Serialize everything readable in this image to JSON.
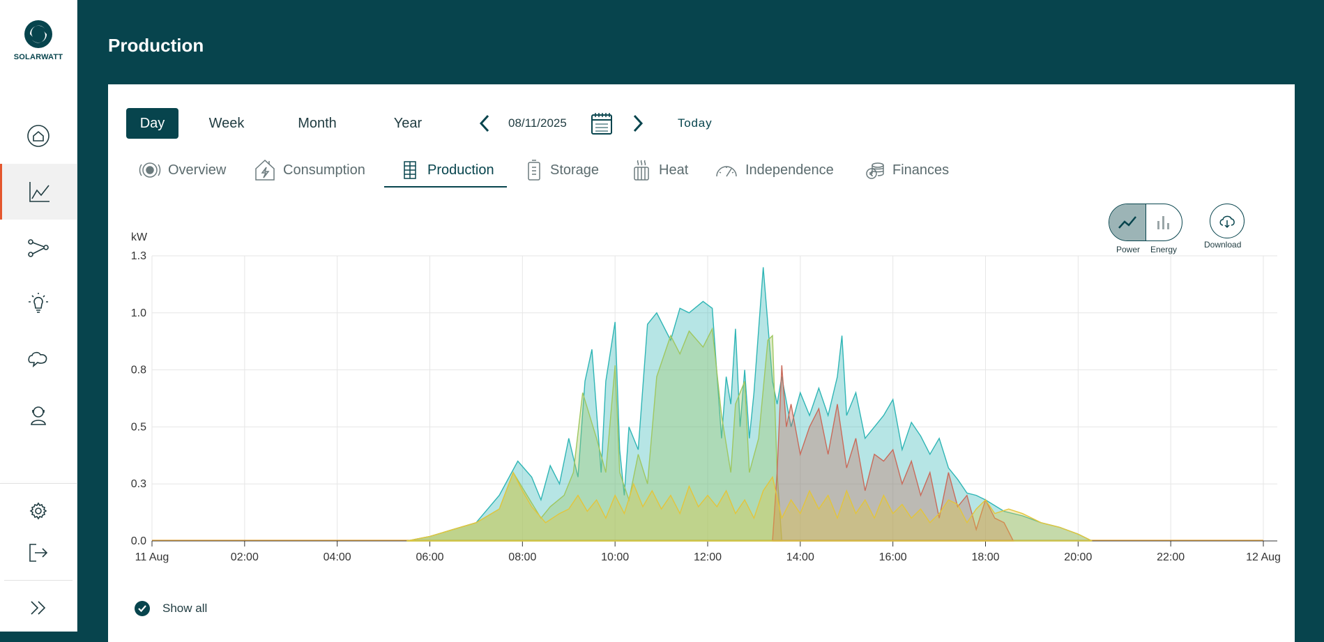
{
  "brand": {
    "name": "SOLARWATT"
  },
  "sidebar": {
    "items": [
      {
        "icon": "home-icon",
        "active": false
      },
      {
        "icon": "chart-icon",
        "active": true
      },
      {
        "icon": "network-icon",
        "active": false
      },
      {
        "icon": "lightbulb-icon",
        "active": false
      },
      {
        "icon": "chat-icon",
        "active": false
      },
      {
        "icon": "support-icon",
        "active": false
      }
    ],
    "bottom": [
      {
        "icon": "gear-icon"
      },
      {
        "icon": "logout-icon"
      },
      {
        "icon": "expand-icon"
      }
    ]
  },
  "header": {
    "title": "Production"
  },
  "period": {
    "options": [
      "Day",
      "Week",
      "Month",
      "Year"
    ],
    "selected": "Day",
    "date": "08/11/2025",
    "today_label": "Today"
  },
  "tabs": [
    {
      "label": "Overview",
      "icon": "overview-icon"
    },
    {
      "label": "Consumption",
      "icon": "house-bolt-icon"
    },
    {
      "label": "Production",
      "icon": "solar-panel-icon",
      "active": true
    },
    {
      "label": "Storage",
      "icon": "battery-icon"
    },
    {
      "label": "Heat",
      "icon": "heater-icon"
    },
    {
      "label": "Independence",
      "icon": "gauge-icon"
    },
    {
      "label": "Finances",
      "icon": "coins-icon"
    }
  ],
  "chart_controls": {
    "power_label": "Power",
    "energy_label": "Energy",
    "download_label": "Download",
    "mode": "Power"
  },
  "show_all_label": "Show all",
  "chart_data": {
    "type": "area",
    "ylabel": "kW",
    "x_tick_labels": [
      "11 Aug",
      "02:00",
      "04:00",
      "06:00",
      "08:00",
      "10:00",
      "12:00",
      "14:00",
      "16:00",
      "18:00",
      "20:00",
      "22:00",
      "12 Aug"
    ],
    "y_tick_labels": [
      "0.0",
      "0.3",
      "0.5",
      "0.8",
      "1.0",
      "1.3"
    ],
    "ylim": [
      0,
      1.25
    ],
    "xlim_hours": [
      0,
      24
    ],
    "grid": true,
    "colors": {
      "total": "#2fb5b5",
      "green": "#9fc760",
      "red": "#c96a5a",
      "yellow": "#e3c53c"
    },
    "series": [
      {
        "color": "total",
        "x": [
          5.5,
          6.0,
          6.5,
          7.0,
          7.5,
          7.9,
          8.2,
          8.4,
          8.6,
          8.8,
          9.0,
          9.2,
          9.35,
          9.5,
          9.7,
          9.8,
          10.0,
          10.1,
          10.2,
          10.3,
          10.5,
          10.7,
          10.9,
          11.2,
          11.4,
          11.6,
          11.9,
          12.1,
          12.3,
          12.4,
          12.5,
          12.6,
          12.7,
          12.8,
          12.9,
          13.0,
          13.2,
          13.4,
          13.5,
          13.6,
          13.8,
          14.0,
          14.2,
          14.4,
          14.6,
          14.8,
          14.9,
          15.0,
          15.2,
          15.4,
          15.6,
          15.8,
          16.0,
          16.2,
          16.4,
          16.6,
          16.8,
          17.0,
          17.2,
          17.4,
          17.6,
          17.8,
          18.0,
          18.4,
          18.8,
          19.2,
          19.6,
          20.0,
          20.2,
          20.3
        ],
        "y": [
          0.0,
          0.02,
          0.05,
          0.08,
          0.2,
          0.35,
          0.28,
          0.18,
          0.33,
          0.25,
          0.45,
          0.28,
          0.7,
          0.84,
          0.3,
          0.7,
          0.96,
          0.4,
          0.2,
          0.5,
          0.4,
          0.95,
          1.0,
          0.88,
          1.02,
          1.0,
          1.05,
          1.02,
          0.45,
          0.72,
          0.6,
          0.93,
          0.5,
          0.75,
          0.45,
          0.65,
          1.2,
          0.7,
          0.6,
          0.72,
          0.5,
          0.65,
          0.55,
          0.67,
          0.55,
          0.72,
          0.9,
          0.55,
          0.65,
          0.45,
          0.5,
          0.55,
          0.62,
          0.4,
          0.52,
          0.46,
          0.38,
          0.45,
          0.32,
          0.27,
          0.21,
          0.2,
          0.18,
          0.13,
          0.11,
          0.08,
          0.06,
          0.03,
          0.01,
          0.0
        ]
      },
      {
        "color": "green",
        "x": [
          5.5,
          6.0,
          6.5,
          7.0,
          7.5,
          7.8,
          8.1,
          8.4,
          8.6,
          8.9,
          9.1,
          9.3,
          9.6,
          9.8,
          10.0,
          10.1,
          10.3,
          10.5,
          10.7,
          10.9,
          11.2,
          11.4,
          11.6,
          11.9,
          12.1,
          12.3,
          12.5,
          12.6,
          12.8,
          12.9,
          13.1,
          13.3,
          13.4,
          13.5,
          13.6
        ],
        "y": [
          0.0,
          0.02,
          0.05,
          0.08,
          0.14,
          0.3,
          0.2,
          0.1,
          0.15,
          0.2,
          0.3,
          0.65,
          0.45,
          0.3,
          0.77,
          0.3,
          0.18,
          0.38,
          0.25,
          0.72,
          0.9,
          0.82,
          0.92,
          0.85,
          0.93,
          0.55,
          0.3,
          0.6,
          0.7,
          0.3,
          0.45,
          0.88,
          0.9,
          0.3,
          0.0
        ]
      },
      {
        "color": "red",
        "x": [
          13.4,
          13.5,
          13.6,
          13.7,
          13.8,
          14.0,
          14.2,
          14.4,
          14.6,
          14.8,
          15.0,
          15.2,
          15.4,
          15.6,
          15.8,
          16.0,
          16.2,
          16.4,
          16.6,
          16.8,
          17.0,
          17.2,
          17.4,
          17.6,
          17.8,
          18.0,
          18.2,
          18.4,
          18.6
        ],
        "y": [
          0.0,
          0.3,
          0.77,
          0.5,
          0.6,
          0.38,
          0.5,
          0.58,
          0.38,
          0.6,
          0.32,
          0.45,
          0.22,
          0.38,
          0.35,
          0.4,
          0.25,
          0.35,
          0.2,
          0.3,
          0.1,
          0.3,
          0.15,
          0.2,
          0.05,
          0.18,
          0.1,
          0.08,
          0.0
        ]
      },
      {
        "color": "yellow",
        "x": [
          5.5,
          6.0,
          6.5,
          7.0,
          7.5,
          7.8,
          8.0,
          8.2,
          8.5,
          8.8,
          9.0,
          9.2,
          9.4,
          9.6,
          9.8,
          10.0,
          10.2,
          10.4,
          10.6,
          10.8,
          11.0,
          11.2,
          11.4,
          11.6,
          11.8,
          12.0,
          12.2,
          12.4,
          12.6,
          12.8,
          13.0,
          13.2,
          13.4,
          13.6,
          13.8,
          14.0,
          14.2,
          14.4,
          14.6,
          14.8,
          15.0,
          15.2,
          15.4,
          15.6,
          15.8,
          16.0,
          16.2,
          16.4,
          16.6,
          16.8,
          17.0,
          17.2,
          17.4,
          17.6,
          17.8,
          18.0,
          18.2,
          18.5,
          18.8,
          19.2,
          19.6,
          20.0,
          20.3
        ],
        "y": [
          0.0,
          0.02,
          0.05,
          0.08,
          0.14,
          0.3,
          0.22,
          0.15,
          0.08,
          0.12,
          0.14,
          0.2,
          0.13,
          0.18,
          0.1,
          0.2,
          0.12,
          0.25,
          0.15,
          0.22,
          0.14,
          0.2,
          0.12,
          0.24,
          0.15,
          0.2,
          0.15,
          0.22,
          0.12,
          0.18,
          0.1,
          0.22,
          0.28,
          0.1,
          0.18,
          0.12,
          0.22,
          0.14,
          0.2,
          0.1,
          0.22,
          0.12,
          0.18,
          0.1,
          0.2,
          0.12,
          0.16,
          0.1,
          0.14,
          0.08,
          0.12,
          0.18,
          0.16,
          0.08,
          0.14,
          0.18,
          0.12,
          0.14,
          0.12,
          0.08,
          0.06,
          0.03,
          0.0
        ]
      }
    ]
  }
}
